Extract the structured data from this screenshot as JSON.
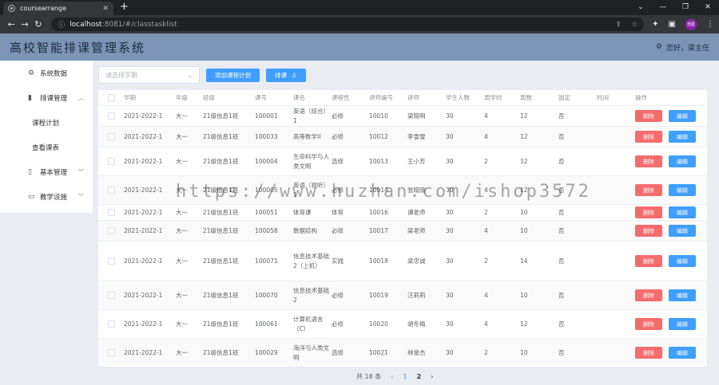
{
  "browser": {
    "tab_title": "coursearrange",
    "url_host": "localhost",
    "url_path": ":8081/#/classtasklist",
    "profile": "浩星"
  },
  "header": {
    "title": "高校智能排课管理系统",
    "greeting": "您好，梁主任"
  },
  "sidebar": {
    "items": [
      {
        "label": "系统数据"
      },
      {
        "label": "排课管理"
      },
      {
        "label": "课程计划"
      },
      {
        "label": "查看课表"
      },
      {
        "label": "基本管理"
      },
      {
        "label": "教学设施"
      }
    ]
  },
  "toolbar": {
    "term_placeholder": "请选择学期",
    "add_plan_label": "添加课程计划",
    "arrange_label": "排课"
  },
  "table": {
    "columns": [
      "学期",
      "年级",
      "班级",
      "课号",
      "课名",
      "课程性",
      "讲师编号",
      "讲师",
      "学生人数",
      "周学时",
      "周数",
      "固定",
      "时间",
      "操作"
    ],
    "rows": [
      {
        "term": "2021-2022-1",
        "grade": "大一",
        "cls": "21级信息1班",
        "cno": "100001",
        "name": "英语（综合）1",
        "nature": "必修",
        "tno": "10010",
        "teacher": "梁晓明",
        "stu": "30",
        "weekh": "4",
        "weeks": "12",
        "fixed": "否",
        "time": ""
      },
      {
        "term": "2021-2022-1",
        "grade": "大一",
        "cls": "21级信息1班",
        "cno": "100033",
        "name": "高等数学II",
        "nature": "必修",
        "tno": "10012",
        "teacher": "李雪雪",
        "stu": "30",
        "weekh": "4",
        "weeks": "12",
        "fixed": "否",
        "time": ""
      },
      {
        "term": "2021-2022-1",
        "grade": "大一",
        "cls": "21级信息1班",
        "cno": "100004",
        "name": "生命科学与人类文明",
        "nature": "选修",
        "tno": "10013",
        "teacher": "王小芳",
        "stu": "30",
        "weekh": "2",
        "weeks": "12",
        "fixed": "否",
        "time": ""
      },
      {
        "term": "2021-2022-1",
        "grade": "大一",
        "cls": "21级信息1班",
        "cno": "100005",
        "name": "英语（视听）1",
        "nature": "必修",
        "tno": "10014",
        "teacher": "张晓晓",
        "stu": "30",
        "weekh": "4",
        "weeks": "12",
        "fixed": "否",
        "time": ""
      },
      {
        "term": "2021-2022-1",
        "grade": "大一",
        "cls": "21级信息1班",
        "cno": "100051",
        "name": "体育课",
        "nature": "体育",
        "tno": "10016",
        "teacher": "谭老师",
        "stu": "30",
        "weekh": "2",
        "weeks": "10",
        "fixed": "否",
        "time": ""
      },
      {
        "term": "2021-2022-1",
        "grade": "大一",
        "cls": "21级信息1班",
        "cno": "100058",
        "name": "数据结构",
        "nature": "必修",
        "tno": "10017",
        "teacher": "梁老师",
        "stu": "30",
        "weekh": "4",
        "weeks": "10",
        "fixed": "否",
        "time": ""
      },
      {
        "term": "2021-2022-1",
        "grade": "大一",
        "cls": "21级信息1班",
        "cno": "100071",
        "name": "信息技术基础2（上机）",
        "nature": "实践",
        "tno": "10018",
        "teacher": "梁忠诚",
        "stu": "30",
        "weekh": "2",
        "weeks": "14",
        "fixed": "否",
        "time": ""
      },
      {
        "term": "2021-2022-1",
        "grade": "大一",
        "cls": "21级信息1班",
        "cno": "100070",
        "name": "信息技术基础2",
        "nature": "必修",
        "tno": "10019",
        "teacher": "汪莉莉",
        "stu": "30",
        "weekh": "4",
        "weeks": "10",
        "fixed": "否",
        "time": ""
      },
      {
        "term": "2021-2022-1",
        "grade": "大一",
        "cls": "21级信息1班",
        "cno": "100061",
        "name": "计算机语言（C）",
        "nature": "必修",
        "tno": "10020",
        "teacher": "胡冬梅",
        "stu": "30",
        "weekh": "4",
        "weeks": "12",
        "fixed": "否",
        "time": ""
      },
      {
        "term": "2021-2022-1",
        "grade": "大一",
        "cls": "21级信息1班",
        "cno": "100029",
        "name": "海洋与人类文明",
        "nature": "选修",
        "tno": "10021",
        "teacher": "林俊杰",
        "stu": "30",
        "weekh": "2",
        "weeks": "10",
        "fixed": "否",
        "time": ""
      }
    ],
    "delete_label": "删除",
    "edit_label": "编辑"
  },
  "pagination": {
    "total": "共 18 条",
    "pages": [
      "1",
      "2"
    ],
    "current": "1"
  },
  "watermark": "https://www.huzhan.com/ishop3572"
}
